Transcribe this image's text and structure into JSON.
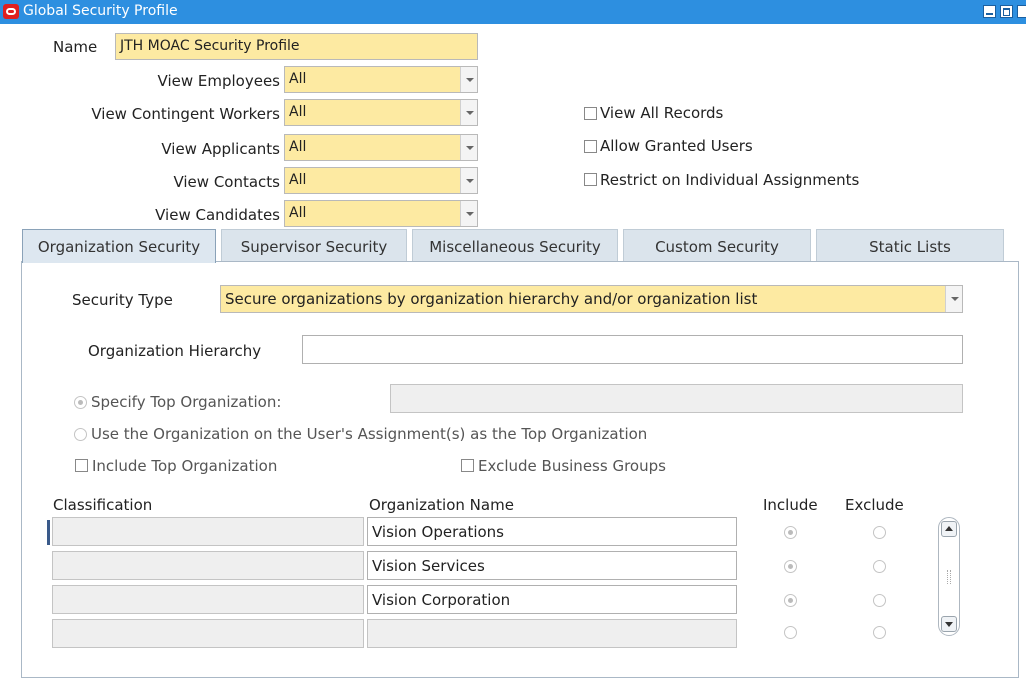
{
  "window": {
    "title": "Global Security Profile",
    "title_bar_color": "#2d8fe0"
  },
  "header": {
    "name_label": "Name",
    "name_value": "JTH MOAC Security Profile",
    "views": [
      {
        "label": "View Employees",
        "value": "All"
      },
      {
        "label": "View Contingent Workers",
        "value": "All"
      },
      {
        "label": "View Applicants",
        "value": "All"
      },
      {
        "label": "View Contacts",
        "value": "All"
      },
      {
        "label": "View Candidates",
        "value": "All"
      }
    ],
    "checkboxes": [
      {
        "label": "View All Records",
        "checked": false
      },
      {
        "label": "Allow Granted Users",
        "checked": false
      },
      {
        "label": "Restrict on Individual Assignments",
        "checked": false
      }
    ]
  },
  "tabs": [
    {
      "label": "Organization Security",
      "active": true
    },
    {
      "label": "Supervisor Security",
      "active": false
    },
    {
      "label": "Miscellaneous Security",
      "active": false
    },
    {
      "label": "Custom Security",
      "active": false
    },
    {
      "label": "Static Lists",
      "active": false
    }
  ],
  "org_security": {
    "security_type_label": "Security Type",
    "security_type_value": "Secure organizations by organization hierarchy and/or organization list",
    "org_hierarchy_label": "Organization Hierarchy",
    "org_hierarchy_value": "",
    "specify_top_label": "Specify Top Organization:",
    "specify_top_value": "",
    "use_user_assignment_label": "Use the Organization on the User's Assignment(s) as the Top Organization",
    "include_top_label": "Include Top Organization",
    "exclude_bg_label": "Exclude Business Groups",
    "table": {
      "columns": [
        "Classification",
        "Organization Name",
        "Include",
        "Exclude"
      ],
      "rows": [
        {
          "classification": "",
          "org_name": "Vision Operations",
          "include": true
        },
        {
          "classification": "",
          "org_name": "Vision Services",
          "include": true
        },
        {
          "classification": "",
          "org_name": "Vision Corporation",
          "include": true
        },
        {
          "classification": "",
          "org_name": "",
          "include": false
        }
      ]
    }
  },
  "colors": {
    "required_field": "#fdeaa2",
    "tab_bg": "#dbe4ec"
  }
}
